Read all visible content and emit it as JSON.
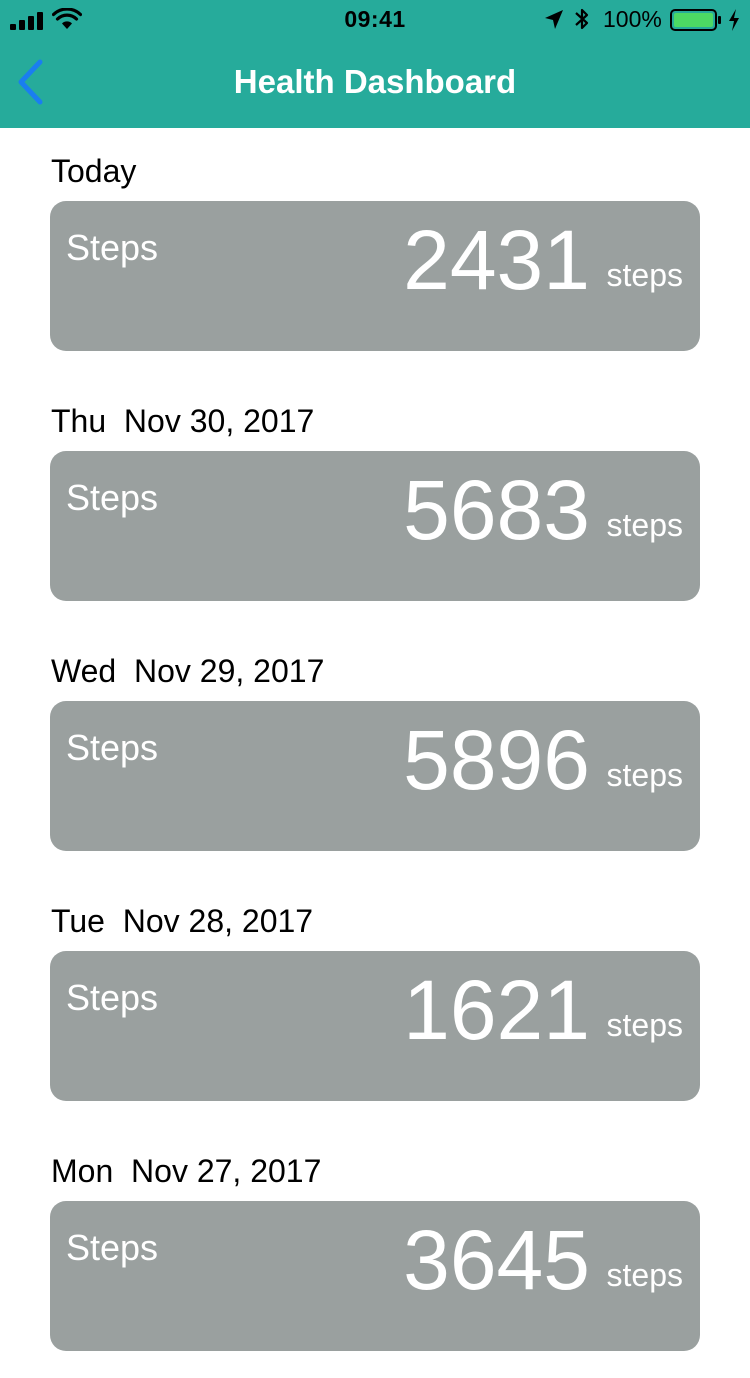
{
  "status_bar": {
    "time": "09:41",
    "battery_percent": "100%"
  },
  "nav": {
    "title": "Health Dashboard",
    "back_icon": "chevron-left-icon"
  },
  "colors": {
    "header": "#26ab9b",
    "back_arrow": "#1a7ef0",
    "card": "#9aa09f",
    "battery_fill": "#4cd964"
  },
  "days": [
    {
      "date_label": "Today",
      "metric_label": "Steps",
      "value": "2431",
      "unit": "steps"
    },
    {
      "date_label": "Thu  Nov 30, 2017",
      "metric_label": "Steps",
      "value": "5683",
      "unit": "steps"
    },
    {
      "date_label": "Wed  Nov 29, 2017",
      "metric_label": "Steps",
      "value": "5896",
      "unit": "steps"
    },
    {
      "date_label": "Tue  Nov 28, 2017",
      "metric_label": "Steps",
      "value": "1621",
      "unit": "steps"
    },
    {
      "date_label": "Mon  Nov 27, 2017",
      "metric_label": "Steps",
      "value": "3645",
      "unit": "steps"
    }
  ]
}
